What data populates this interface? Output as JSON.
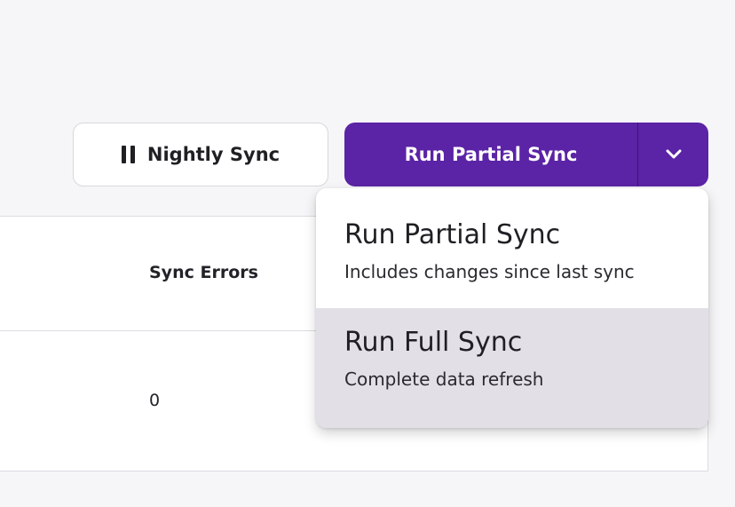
{
  "toolbar": {
    "schedule_button": {
      "label": "Nightly Sync",
      "icon": "pause-icon"
    },
    "sync_button": {
      "label": "Run Partial Sync",
      "toggle_icon": "chevron-down-icon",
      "color": "#5b23a5"
    }
  },
  "table": {
    "columns": [
      "Sync Errors"
    ],
    "rows": [
      [
        "0"
      ]
    ]
  },
  "dropdown": {
    "items": [
      {
        "title": "Run Partial Sync",
        "description": "Includes changes since last sync",
        "highlighted": false
      },
      {
        "title": "Run Full Sync",
        "description": "Complete data refresh",
        "highlighted": true
      }
    ]
  }
}
